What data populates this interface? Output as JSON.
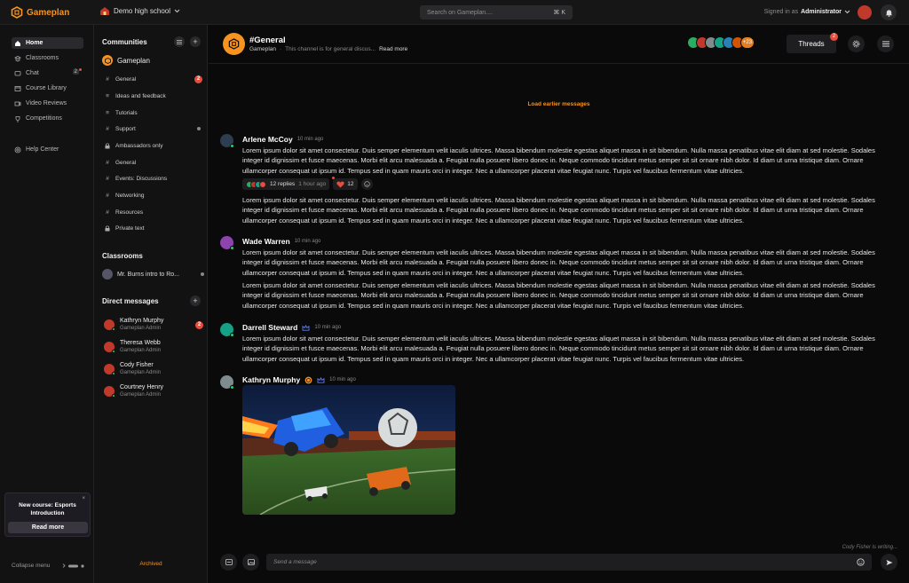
{
  "app": {
    "name": "Gameplan",
    "accent": "#f7931e"
  },
  "topbar": {
    "school": "Demo high school",
    "search_placeholder": "Search on Gameplan....",
    "search_shortcut": "⌘ K",
    "signed_in_prefix": "Signed in as",
    "signed_in_user": "Administrator"
  },
  "nav": {
    "items": [
      {
        "label": "Home",
        "icon": "home-icon"
      },
      {
        "label": "Classrooms",
        "icon": "classroom-icon"
      },
      {
        "label": "Chat",
        "icon": "chat-icon",
        "badge": "2"
      },
      {
        "label": "Course Library",
        "icon": "library-icon"
      },
      {
        "label": "Video Reviews",
        "icon": "video-icon"
      },
      {
        "label": "Competitions",
        "icon": "trophy-icon"
      }
    ],
    "help": "Help Center",
    "promo": {
      "title": "New course: Esports Introduction",
      "button": "Read more"
    },
    "collapse": "Collapse menu"
  },
  "sidebar": {
    "communities_title": "Communities",
    "community_name": "Gameplan",
    "channels": [
      {
        "label": "General",
        "icon": "#",
        "badge": "2"
      },
      {
        "label": "Ideas and feedback",
        "icon": "≡"
      },
      {
        "label": "Tutorials",
        "icon": "≡"
      },
      {
        "label": "Support",
        "icon": "#",
        "dot": true
      },
      {
        "label": "Ambassadors only",
        "icon": "🔒"
      },
      {
        "label": "General",
        "icon": "#"
      },
      {
        "label": "Events: Discussions",
        "icon": "#"
      },
      {
        "label": "Networking",
        "icon": "#"
      },
      {
        "label": "Resources",
        "icon": "#"
      },
      {
        "label": "Private text",
        "icon": "🔒"
      }
    ],
    "classrooms_title": "Classrooms",
    "classroom": "Mr. Burns intro to Ro...",
    "dm_title": "Direct messages",
    "dms": [
      {
        "name": "Kathryn Murphy",
        "role": "Gameplan Admin",
        "badge": "2",
        "color": "#e74c3c"
      },
      {
        "name": "Theresa Webb",
        "role": "Gameplan Admin",
        "color": "#e74c3c"
      },
      {
        "name": "Cody Fisher",
        "role": "Gameplan Admin",
        "color": "#e74c3c"
      },
      {
        "name": "Courtney Henry",
        "role": "Gameplan Admin",
        "color": "#e74c3c"
      }
    ],
    "archived": "Archived"
  },
  "channel": {
    "title": "#General",
    "community": "Gameplan",
    "description": "This channel is for general discus...",
    "read_more": "Read more",
    "member_count": "+23",
    "threads_label": "Threads",
    "threads_badge": "2"
  },
  "load_earlier": "Load earlier messages",
  "messages": [
    {
      "author": "Arlene McCoy",
      "time": "10 min ago",
      "avatar_color": "#2c3e50",
      "paragraphs": [
        "Lorem ipsum dolor sit amet consectetur. Duis semper elementum velit iaculis ultrices. Massa bibendum molestie egestas aliquet massa in sit bibendum. Nulla massa penatibus vitae elit diam at sed molestie. Sodales integer id dignissim et fusce maecenas. Morbi elit arcu malesuada a. Feugiat nulla posuere libero donec in. Neque commodo tincidunt metus semper sit sit ornare nibh dolor. Id diam ut urna tristique diam. Ornare ullamcorper consequat ut ipsum id. Tempus sed in quam mauris orci in integer. Nec a ullamcorper placerat vitae feugiat nunc. Turpis vel faucibus fermentum vitae ultricies.",
        "Lorem ipsum dolor sit amet consectetur. Duis semper elementum velit iaculis ultrices. Massa bibendum molestie egestas aliquet massa in sit bibendum. Nulla massa penatibus vitae elit diam at sed molestie. Sodales integer id dignissim et fusce maecenas. Morbi elit arcu malesuada a. Feugiat nulla posuere libero donec in. Neque commodo tincidunt metus semper sit sit ornare nibh dolor. Id diam ut urna tristique diam. Ornare ullamcorper consequat ut ipsum id. Tempus sed in quam mauris orci in integer. Nec a ullamcorper placerat vitae feugiat nunc. Turpis vel faucibus fermentum vitae ultricies."
      ],
      "replies": "12 replies",
      "reply_time": "1 hour ago",
      "heart_count": "12"
    },
    {
      "author": "Wade Warren",
      "time": "10 min ago",
      "avatar_color": "#8e44ad",
      "paragraphs": [
        "Lorem ipsum dolor sit amet consectetur. Duis semper elementum velit iaculis ultrices. Massa bibendum molestie egestas aliquet massa in sit bibendum. Nulla massa penatibus vitae elit diam at sed molestie. Sodales integer id dignissim et fusce maecenas. Morbi elit arcu malesuada a. Feugiat nulla posuere libero donec in. Neque commodo tincidunt metus semper sit sit ornare nibh dolor. Id diam ut urna tristique diam. Ornare ullamcorper consequat ut ipsum id. Tempus sed in quam mauris orci in integer. Nec a ullamcorper placerat vitae feugiat nunc. Turpis vel faucibus fermentum vitae ultricies.",
        "Lorem ipsum dolor sit amet consectetur. Duis semper elementum velit iaculis ultrices. Massa bibendum molestie egestas aliquet massa in sit bibendum. Nulla massa penatibus vitae elit diam at sed molestie. Sodales integer id dignissim et fusce maecenas. Morbi elit arcu malesuada a. Feugiat nulla posuere libero donec in. Neque commodo tincidunt metus semper sit sit ornare nibh dolor. Id diam ut urna tristique diam. Ornare ullamcorper consequat ut ipsum id. Tempus sed in quam mauris orci in integer. Nec a ullamcorper placerat vitae feugiat nunc. Turpis vel faucibus fermentum vitae ultricies."
      ]
    },
    {
      "author": "Darrell Steward",
      "time": "10 min ago",
      "avatar_color": "#16a085",
      "paragraphs": [
        "Lorem ipsum dolor sit amet consectetur. Duis semper elementum velit iaculis ultrices. Massa bibendum molestie egestas aliquet massa in sit bibendum. Nulla massa penatibus vitae elit diam at sed molestie. Sodales integer id dignissim et fusce maecenas. Morbi elit arcu malesuada a. Feugiat nulla posuere libero donec in. Neque commodo tincidunt metus semper sit sit ornare nibh dolor. Id diam ut urna tristique diam. Ornare ullamcorper consequat ut ipsum id. Tempus sed in quam mauris orci in integer. Nec a ullamcorper placerat vitae feugiat nunc. Turpis vel faucibus fermentum vitae ultricies."
      ]
    },
    {
      "author": "Kathryn Murphy",
      "time": "10 min ago",
      "avatar_color": "#7f8c8d"
    }
  ],
  "typing": "Cody Fisher is writing...",
  "composer": {
    "placeholder": "Send a message"
  }
}
